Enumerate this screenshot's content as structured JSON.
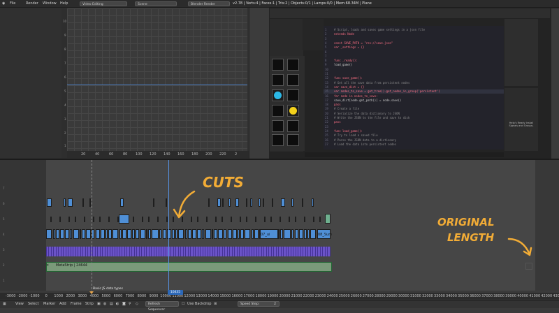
{
  "topbar": {
    "menus": [
      "File",
      "Render",
      "Window",
      "Help"
    ],
    "screen_layout": "Video Editing",
    "scene": "Scene",
    "render_engine": "Blender Render",
    "stats": "v2.78 | Verts:4 | Faces:1 | Tris:2 | Objects:0/1 | Lamps:0/0 | Mem:68.34M | Plane"
  },
  "graph": {
    "x_ticks": [
      "20",
      "40",
      "60",
      "80",
      "100",
      "120",
      "140",
      "160",
      "180",
      "200",
      "220",
      "2"
    ],
    "y_ticks": [
      "10",
      "9",
      "8",
      "7",
      "6",
      "5",
      "4",
      "3",
      "2",
      "1"
    ]
  },
  "editor": {
    "code_lines": [
      "# Script, loads and saves game settings in a json file",
      "extends Node",
      "",
      "const SAVE_PATH = \"res://save.json\"",
      "var _settings = {}",
      "",
      "",
      "func _ready():",
      "    load_game()",
      "",
      "",
      "func save_game():",
      "    # Get all the save data from persistent nodes",
      "    var save_dict = {}",
      "    var nodes_to_save = get_tree().get_nodes_in_group('persistent')",
      "    for node in nodes_to_save:",
      "        save_dict[node.get_path()] = node.save()",
      "        pass",
      "    # Create a file",
      "    # Serialize the data dictionary to JSON",
      "    # Write the JSON to the file and save to disk",
      "    pass",
      "",
      "func load_game():",
      "    # Try to load a saved file",
      "    # Parse the JSON data to a dictionary",
      "    # Load the data into persistent nodes"
    ],
    "line_numbers": [
      "1",
      "2",
      "3",
      "4",
      "5",
      "6",
      "7",
      "8",
      "9",
      "10",
      "11",
      "12",
      "13",
      "14",
      "15",
      "16",
      "17",
      "18",
      "19",
      "20",
      "21",
      "22",
      "23",
      "24",
      "25",
      "26",
      "27"
    ],
    "help_text": "Help's Ready Install Signals and Groups."
  },
  "sequencer": {
    "channels": [
      "7",
      "6",
      "5",
      "4",
      "3",
      "2",
      "1"
    ],
    "metastrip_label": "MetaStrip | 24644",
    "strip_labels": [
      "07_ui",
      "08_Sum"
    ]
  },
  "ruler": {
    "ticks": [
      "-3000",
      "-2000",
      "-1000",
      "0",
      "1000",
      "2000",
      "3000",
      "4000",
      "5000",
      "6000",
      "7000",
      "8000",
      "9000",
      "10000",
      "11000",
      "12000",
      "13000",
      "14000",
      "15000",
      "16000",
      "17000",
      "18000",
      "19000",
      "20000",
      "21000",
      "22000",
      "23000",
      "24000",
      "25000",
      "26000",
      "27000",
      "28000",
      "29000",
      "30000",
      "31000",
      "32000",
      "33000",
      "34000",
      "35000",
      "36000",
      "37000",
      "38000",
      "39000",
      "40000",
      "41000",
      "42000",
      "43000",
      "44000"
    ],
    "current_frame": "10435",
    "marker": "Basic JS data types"
  },
  "bottombar": {
    "menus": [
      "View",
      "Select",
      "Marker",
      "Add",
      "Frame",
      "Strip"
    ],
    "refresh_label": "Refresh Sequencer",
    "backdrop_label": "Use Backdrop",
    "speed_label": "Speed Step:",
    "speed_value": "2"
  },
  "annotations": {
    "cuts": "CUTS",
    "original_line1": "ORIGINAL",
    "original_line2": "LENGTH"
  },
  "colors": {
    "accent": "#5794e6",
    "annotation": "#f2ac36",
    "strip_blue": "#4f8fd6",
    "strip_purple": "#6b53c8",
    "strip_meta": "#7a9a7a"
  }
}
